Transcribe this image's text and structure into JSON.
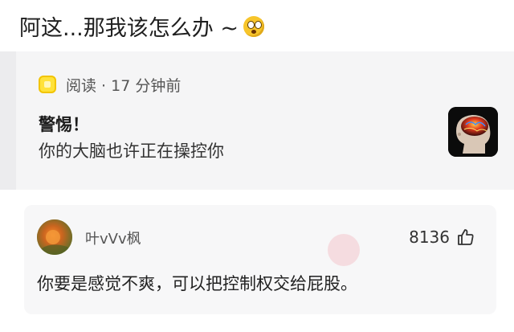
{
  "post": {
    "title": "阿这...那我该怎么办 ~",
    "title_emoji": "astonished-face-icon"
  },
  "shared_card": {
    "app_icon": "read-app-icon",
    "source": "阅读 · 17 分钟前",
    "title": "警惕！",
    "description": "你的大脑也许正在操控你",
    "thumbnail": "brain-head-image"
  },
  "comment": {
    "avatar": "user-avatar",
    "username": "叶vVv枫",
    "likes": "8136",
    "like_icon": "thumbs-up-icon",
    "text": "你要是感觉不爽，可以把控制权交给屁股。"
  },
  "colors": {
    "card_bg": "#f5f5f6",
    "app_icon_yellow": "#ffe23a",
    "text_primary": "#222222",
    "text_secondary": "#555555"
  }
}
